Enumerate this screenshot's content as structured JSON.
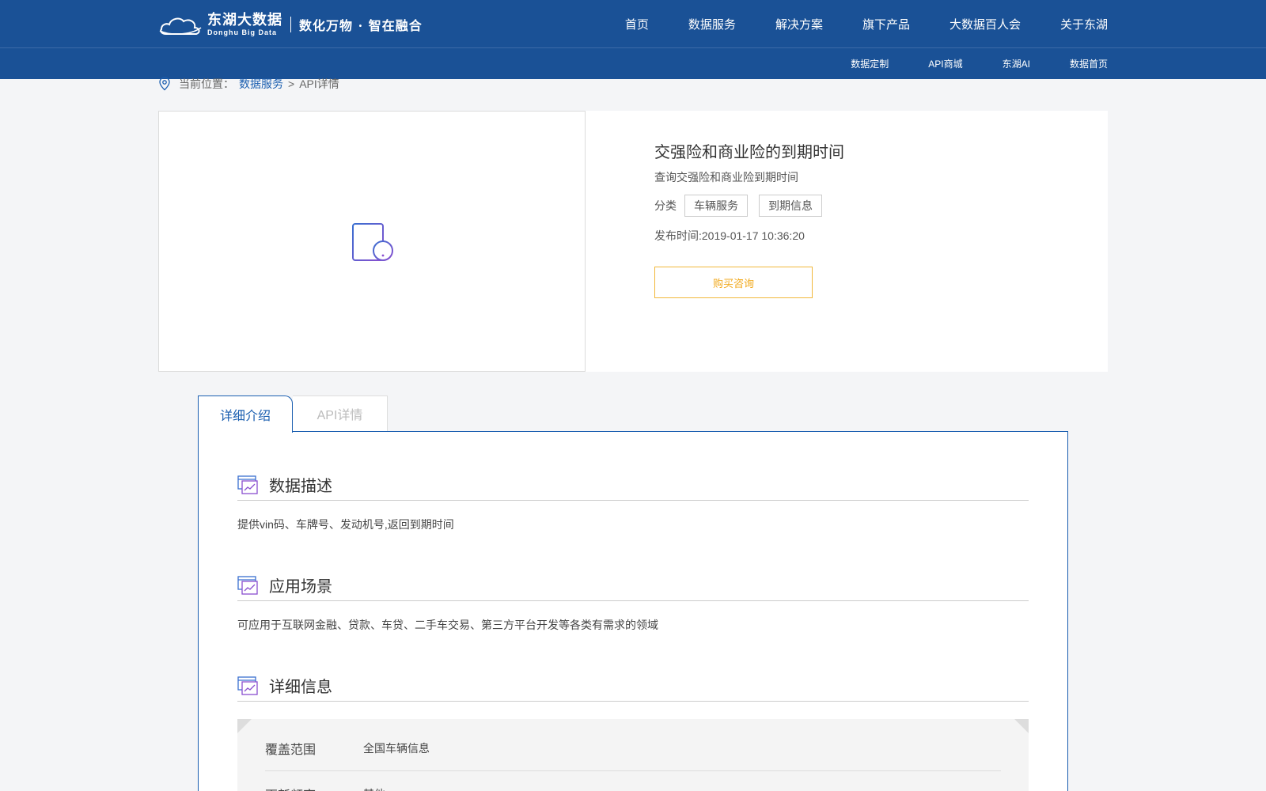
{
  "header": {
    "logo_cn": "东湖大数据",
    "logo_en": "Donghu Big Data",
    "slogan": "数化万物 · 智在融合",
    "main_nav": [
      "首页",
      "数据服务",
      "解决方案",
      "旗下产品",
      "大数据百人会",
      "关于东湖"
    ],
    "sub_nav": [
      "数据定制",
      "API商城",
      "东湖AI",
      "数据首页"
    ]
  },
  "breadcrumb": {
    "label": "当前位置：",
    "link": "数据服务",
    "sep": ">",
    "current": "API详情"
  },
  "product": {
    "title": "交强险和商业险的到期时间",
    "subtitle": "查询交强险和商业险到期时间",
    "category_label": "分类",
    "tags": [
      "车辆服务",
      "到期信息"
    ],
    "publish_time": "发布时间:2019-01-17 10:36:20",
    "buy_button": "购买咨询"
  },
  "tabs": [
    {
      "label": "详细介绍",
      "active": true
    },
    {
      "label": "API详情",
      "active": false
    }
  ],
  "sections": [
    {
      "title": "数据描述",
      "text": "提供vin码、车牌号、发动机号,返回到期时间"
    },
    {
      "title": "应用场景",
      "text": "可应用于互联网金融、贷款、车贷、二手车交易、第三方平台开发等各类有需求的领域"
    },
    {
      "title": "详细信息"
    }
  ],
  "details": [
    {
      "key": "覆盖范围",
      "value": "全国车辆信息"
    },
    {
      "key": "更新频率",
      "value": "其他"
    }
  ],
  "colors": {
    "header_bg": "#1a5196",
    "link_blue": "#1a5eb0",
    "buy_orange": "#f1a81b"
  }
}
